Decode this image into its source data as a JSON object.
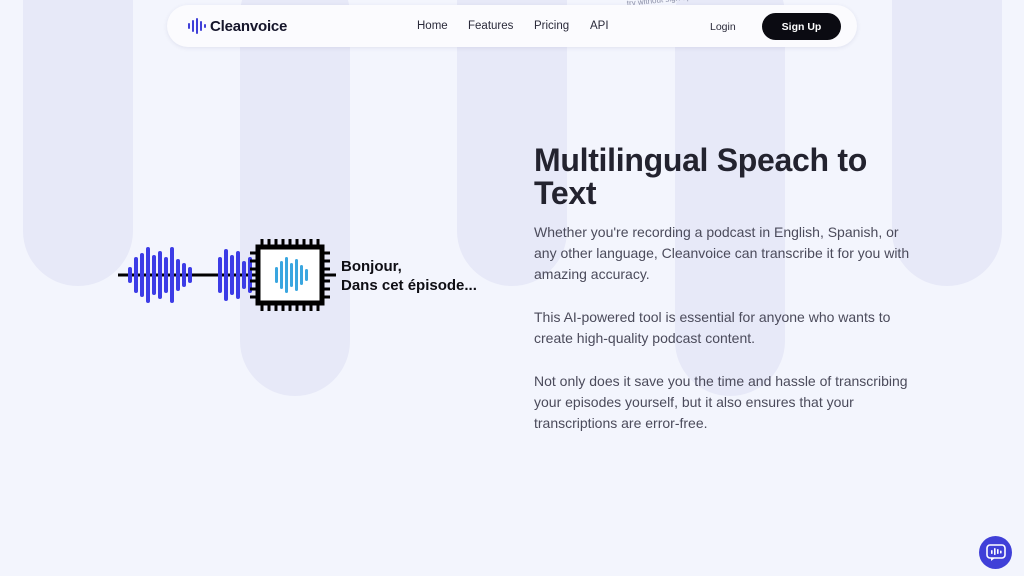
{
  "nav": {
    "brand": "Cleanvoice",
    "links": [
      "Home",
      "Features",
      "Pricing",
      "API"
    ],
    "login": "Login",
    "signup": "Sign Up",
    "promo_fragment": "...try without sign up"
  },
  "illustration": {
    "caption_line1": "Bonjour,",
    "caption_line2": "Dans cet épisode..."
  },
  "content": {
    "title": "Multilingual Speach to Text",
    "paragraphs": [
      "Whether you're recording a podcast in English, Spanish, or any other language, Cleanvoice can transcribe it for you with amazing accuracy.",
      "This AI-powered tool is essential for anyone who wants to create high-quality podcast content.",
      "Not only does it save you the time and hassle of transcribing your episodes yourself, but it also ensures that your transcriptions are error-free."
    ]
  },
  "colors": {
    "accent": "#4040d8",
    "wave_blue": "#3c3ce6",
    "wave_cyan": "#3aa6e0",
    "background": "#f3f5fd",
    "pill": "#e7e9f8"
  },
  "icons": [
    "cleanvoice-logo-icon",
    "waveform-icon",
    "chip-icon",
    "chat-widget-icon"
  ]
}
